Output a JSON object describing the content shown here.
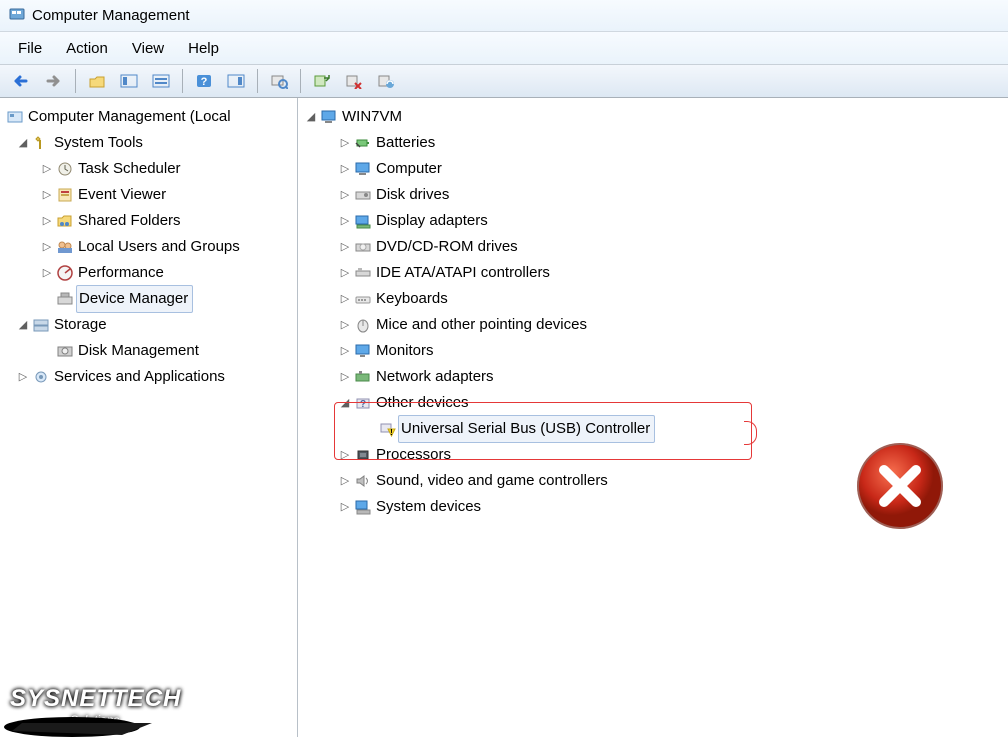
{
  "window": {
    "title": "Computer Management"
  },
  "menu": {
    "file": "File",
    "action": "Action",
    "view": "View",
    "help": "Help"
  },
  "left_tree": {
    "root": "Computer Management (Local",
    "system_tools": "System Tools",
    "task_scheduler": "Task Scheduler",
    "event_viewer": "Event Viewer",
    "shared_folders": "Shared Folders",
    "local_users": "Local Users and Groups",
    "performance": "Performance",
    "device_manager": "Device Manager",
    "storage": "Storage",
    "disk_management": "Disk Management",
    "services_apps": "Services and Applications"
  },
  "right_tree": {
    "root": "WIN7VM",
    "batteries": "Batteries",
    "computer": "Computer",
    "disk_drives": "Disk drives",
    "display_adapters": "Display adapters",
    "dvd": "DVD/CD-ROM drives",
    "ide": "IDE ATA/ATAPI controllers",
    "keyboards": "Keyboards",
    "mice": "Mice and other pointing devices",
    "monitors": "Monitors",
    "network": "Network adapters",
    "other_devices": "Other devices",
    "usb_controller": "Universal Serial Bus (USB) Controller",
    "processors": "Processors",
    "sound": "Sound, video and game controllers",
    "system_devices": "System devices"
  },
  "watermark": {
    "line1": "SYSNETTECH",
    "line2": "Solutions"
  }
}
